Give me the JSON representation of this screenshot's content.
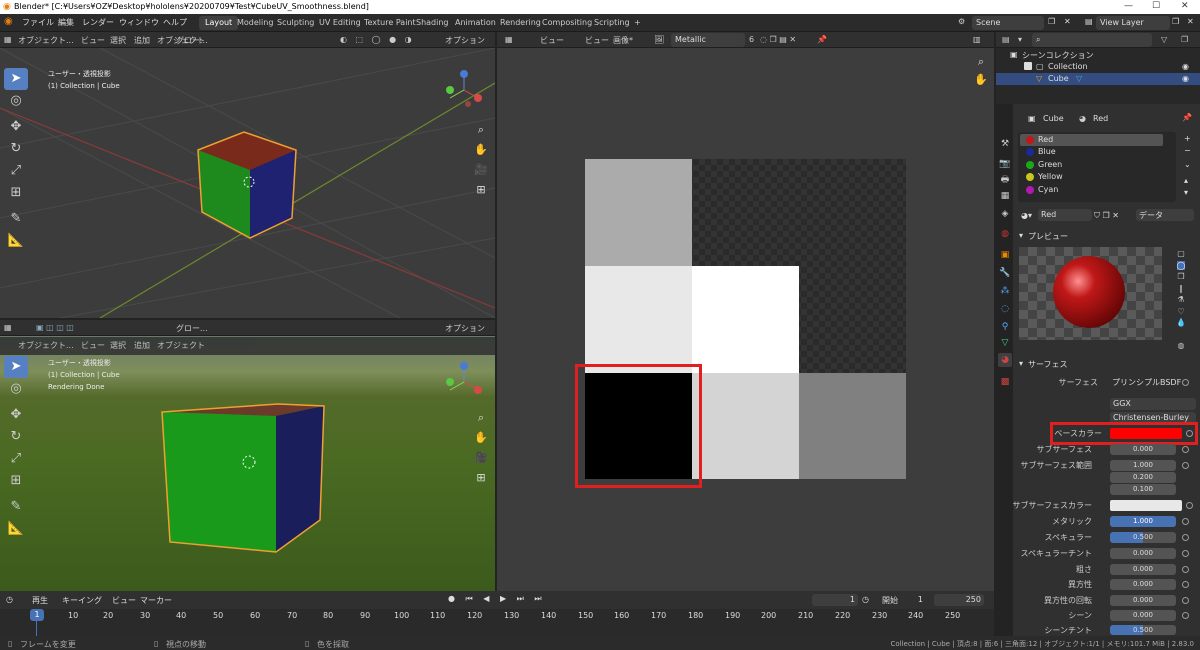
{
  "window": {
    "title": "Blender* [C:¥Users¥OZ¥Desktop¥hololens¥20200709¥Test¥CubeUV_Smoothness.blend]",
    "min": "—",
    "max": "☐",
    "close": "✕"
  },
  "menu": [
    "ファイル",
    "編集",
    "レンダー",
    "ウィンドウ",
    "ヘルプ"
  ],
  "workspaces": [
    "Layout",
    "Modeling",
    "Sculpting",
    "UV Editing",
    "Texture Paint",
    "Shading",
    "Animation",
    "Rendering",
    "Compositing",
    "Scripting",
    "+"
  ],
  "scene": {
    "label": "Scene",
    "viewlayer": "View Layer"
  },
  "vp_top": {
    "mode": "オブジェクト...",
    "menu": [
      "ビュー",
      "選択",
      "追加",
      "オブジェクト"
    ],
    "orient": "グロー...",
    "options": "オプション",
    "view_name": "ユーザー・透視投影",
    "collection": "(1) Collection | Cube"
  },
  "vp_bottom": {
    "mode": "オブジェクト...",
    "menu": [
      "ビュー",
      "選択",
      "追加",
      "オブジェクト"
    ],
    "orient": "グロー...",
    "options": "オプション",
    "view_name": "ユーザー・透視投影",
    "collection": "(1) Collection | Cube",
    "status": "Rendering Done"
  },
  "image_editor": {
    "menu": [
      "ビュー",
      "ビュー",
      "画像*"
    ],
    "image_name": "Metallic",
    "users": "6"
  },
  "outliner": {
    "root": "シーンコレクション",
    "collection": "Collection",
    "object": "Cube"
  },
  "props": {
    "object": "Cube",
    "material": "Red",
    "materials": [
      {
        "name": "Red",
        "color": "#c01818"
      },
      {
        "name": "Blue",
        "color": "#1a2a9a"
      },
      {
        "name": "Green",
        "color": "#1aa81a"
      },
      {
        "name": "Yellow",
        "color": "#c8c81a"
      },
      {
        "name": "Cyan",
        "color": "#b01ab0"
      }
    ],
    "mat_slot": "Red",
    "mat_link": "データ",
    "preview_label": "プレビュー",
    "surface_label": "サーフェス",
    "surface_name": "サーフェス",
    "surface_value": "プリンシプルBSDF",
    "distribution": "GGX",
    "sss_method": "Christensen-Burley",
    "base_color_label": "ベースカラー",
    "base_color": "#ff0000",
    "subsurface_label": "サブサーフェス",
    "subsurface": "0.000",
    "subsurface_radius_label": "サブサーフェス範囲",
    "radius": [
      "1.000",
      "0.200",
      "0.100"
    ],
    "subsurface_color_label": "サブサーフェスカラー",
    "metallic_label": "メタリック",
    "metallic": "1.000",
    "specular_label": "スペキュラー",
    "specular": "0.500",
    "specular_tint_label": "スペキュラーチント",
    "specular_tint": "0.000",
    "roughness_label": "粗さ",
    "roughness": "0.000",
    "aniso_label": "異方性",
    "aniso": "0.000",
    "aniso_rot_label": "異方性の回転",
    "aniso_rot": "0.000",
    "sheen_label": "シーン",
    "sheen": "0.000",
    "sheen_tint_label": "シーンチント",
    "sheen_tint": "0.500"
  },
  "timeline": {
    "menu": [
      "再生",
      "キーイング",
      "ビュー",
      "マーカー"
    ],
    "current": "1",
    "start_label": "開始",
    "start": "1",
    "end_label": "終了",
    "end": "250",
    "ticks": [
      "1",
      "10",
      "20",
      "30",
      "40",
      "50",
      "60",
      "70",
      "80",
      "90",
      "100",
      "110",
      "120",
      "130",
      "140",
      "150",
      "160",
      "170",
      "180",
      "190",
      "200",
      "210",
      "220",
      "230",
      "240",
      "250"
    ]
  },
  "status": {
    "left": "フレームを変更",
    "mid": "視点の移動",
    "mid2": "色を採取",
    "right": "Collection | Cube | 頂点:8 | 面:6 | 三角面:12 | オブジェクト:1/1 | メモリ:101.7 MiB | 2.83.0"
  },
  "colors": {
    "highlight": "#e02020",
    "accent": "#4772b3",
    "selection": "#f0a030"
  }
}
